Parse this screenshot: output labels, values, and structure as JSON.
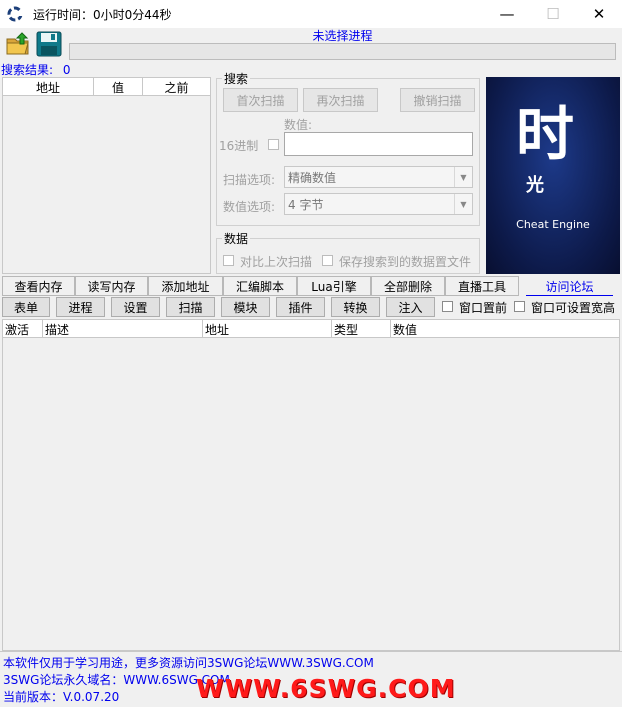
{
  "window": {
    "title": "运行时间：0小时0分44秒",
    "minimize": "—",
    "maximize": "☐",
    "close": "✕"
  },
  "process": {
    "status": "未选择进程"
  },
  "search_results": {
    "label": "搜索结果:",
    "count": "0"
  },
  "results_table": {
    "columns": [
      "地址",
      "值",
      "之前"
    ]
  },
  "search": {
    "group_title": "搜索",
    "first_scan": "首次扫描",
    "next_scan": "再次扫描",
    "undo_scan": "撤销扫描",
    "value_label": "数值:",
    "hex_label": "16进制",
    "scan_option_label": "扫描选项:",
    "scan_option_value": "精确数值",
    "value_option_label": "数值选项:",
    "value_option_value": "4 字节"
  },
  "data_group": {
    "title": "数据",
    "compare_last": "对比上次扫描",
    "save_to_file": "保存搜索到的数据置文件"
  },
  "logo": {
    "glyph_main": "时",
    "glyph_sub": "光",
    "caption": "Cheat Engine"
  },
  "tabs": [
    "查看内存",
    "读写内存",
    "添加地址",
    "汇编脚本",
    "Lua引擎",
    "全部删除",
    "直播工具",
    "访问论坛"
  ],
  "menu": [
    "表单",
    "进程",
    "设置",
    "扫描",
    "模块",
    "插件",
    "转换",
    "注入"
  ],
  "options": {
    "topmost": "窗口置前",
    "resizable": "窗口可设置宽高"
  },
  "cheat_table": {
    "columns": [
      "激活",
      "描述",
      "地址",
      "类型",
      "数值"
    ]
  },
  "footer": {
    "line1": "本软件仅用于学习用途，更多资源访问3SWG论坛WWW.3SWG.COM",
    "line2": "3SWG论坛永久域名：WWW.6SWG.COM",
    "line3": "当前版本：V.0.07.20",
    "watermark": "WWW.6SWG.COM"
  },
  "colors": {
    "link_blue": "#0000ee",
    "logo_bg": "#0d1a4a",
    "watermark_red": "#ff1a1a"
  }
}
